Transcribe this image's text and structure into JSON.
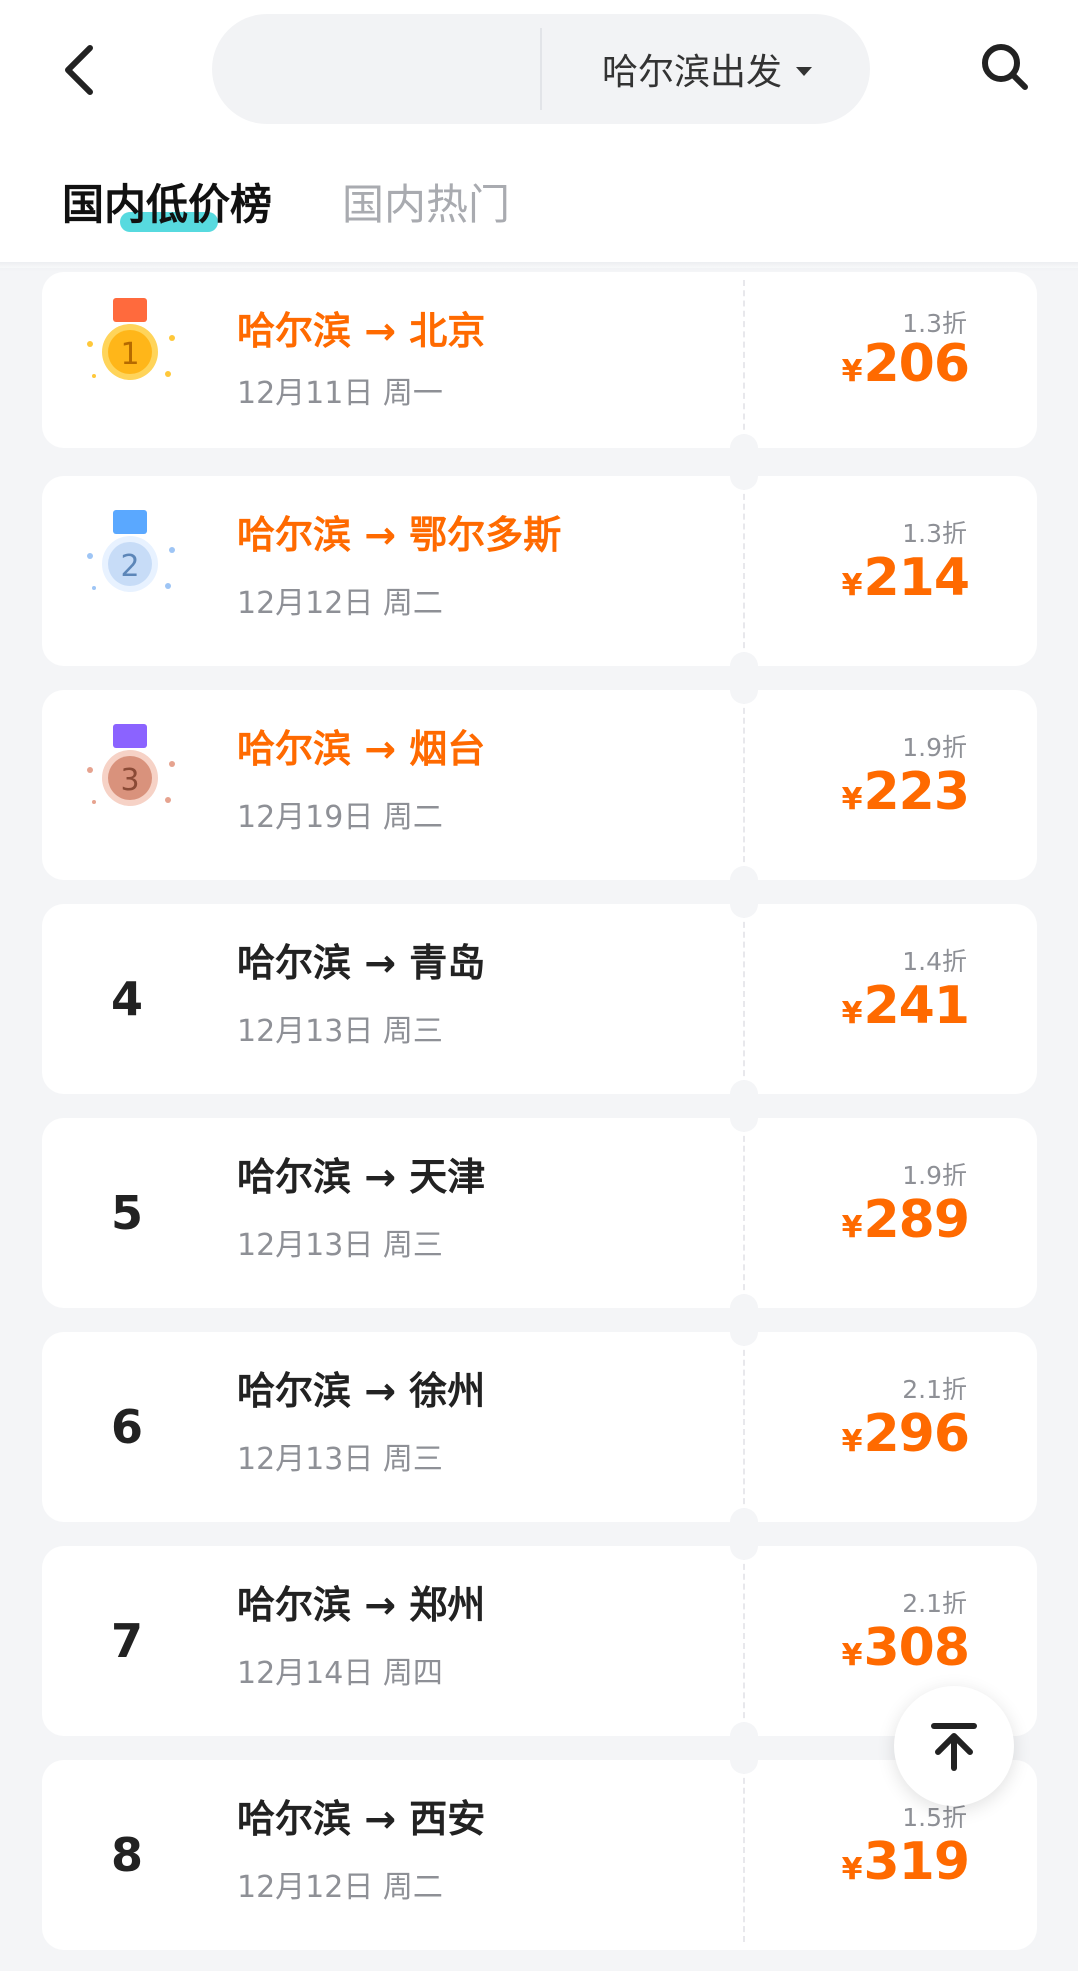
{
  "header": {
    "departure_city": "哈尔滨出发",
    "search_placeholder": ""
  },
  "tabs": [
    {
      "label": "国内低价榜",
      "active": true
    },
    {
      "label": "国内热门",
      "active": false
    }
  ],
  "colors": {
    "accent": "#ff6a00",
    "tab_indicator": "#39d4d9"
  },
  "routes": [
    {
      "rank": "1",
      "medal": "gold-medal-icon",
      "route": "哈尔滨 → 北京",
      "date": "12月11日 周一",
      "discount": "1.3折",
      "currency": "¥",
      "price": "206"
    },
    {
      "rank": "2",
      "medal": "silver-medal-icon",
      "route": "哈尔滨 → 鄂尔多斯",
      "date": "12月12日 周二",
      "discount": "1.3折",
      "currency": "¥",
      "price": "214"
    },
    {
      "rank": "3",
      "medal": "bronze-medal-icon",
      "route": "哈尔滨 → 烟台",
      "date": "12月19日 周二",
      "discount": "1.9折",
      "currency": "¥",
      "price": "223"
    },
    {
      "rank": "4",
      "route": "哈尔滨 → 青岛",
      "date": "12月13日 周三",
      "discount": "1.4折",
      "currency": "¥",
      "price": "241"
    },
    {
      "rank": "5",
      "route": "哈尔滨 → 天津",
      "date": "12月13日 周三",
      "discount": "1.9折",
      "currency": "¥",
      "price": "289"
    },
    {
      "rank": "6",
      "route": "哈尔滨 → 徐州",
      "date": "12月13日 周三",
      "discount": "2.1折",
      "currency": "¥",
      "price": "296"
    },
    {
      "rank": "7",
      "route": "哈尔滨 → 郑州",
      "date": "12月14日 周四",
      "discount": "2.1折",
      "currency": "¥",
      "price": "308"
    },
    {
      "rank": "8",
      "route": "哈尔滨 → 西安",
      "date": "12月12日 周二",
      "discount": "1.5折",
      "currency": "¥",
      "price": "319"
    }
  ]
}
